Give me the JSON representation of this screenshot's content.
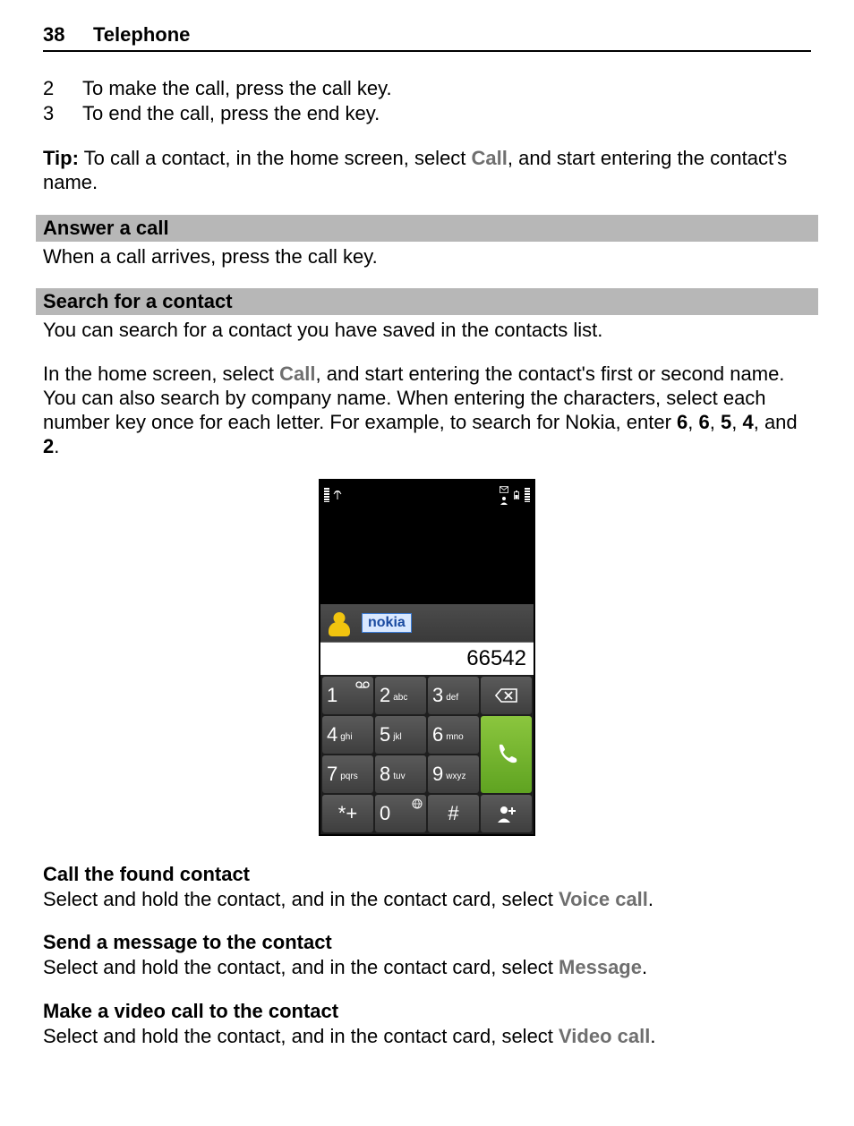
{
  "header": {
    "page_number": "38",
    "chapter": "Telephone"
  },
  "steps": [
    {
      "n": "2",
      "text": "To make the call, press the call key."
    },
    {
      "n": "3",
      "text": "To end the call, press the end key."
    }
  ],
  "tip": {
    "label": "Tip:",
    "before": " To call a contact, in the home screen, select ",
    "call_label": "Call",
    "after": ", and start entering the contact's name."
  },
  "answer": {
    "heading": "Answer a call",
    "text": "When a call arrives, press the call key."
  },
  "search": {
    "heading": "Search for a contact",
    "intro": "You can search for a contact you have saved in the contacts list.",
    "p_before": "In the home screen, select ",
    "call_label": "Call",
    "p_after1": ", and start entering the contact's first or second name. You can also search by company name. When entering the characters, select each number key once for each letter. For example, to search for Nokia, enter ",
    "d1": "6",
    "d2": "6",
    "d3": "5",
    "d4": "4",
    "d5": "2",
    "comma": ", ",
    "and": ", and ",
    "period": "."
  },
  "phone": {
    "match_text": "nokia",
    "typed_number": "66542",
    "keys": {
      "k1": "1",
      "k1s": "",
      "k2": "2",
      "k2s": "abc",
      "k3": "3",
      "k3s": "def",
      "k4": "4",
      "k4s": "ghi",
      "k5": "5",
      "k5s": "jkl",
      "k6": "6",
      "k6s": "mno",
      "k7": "7",
      "k7s": "pqrs",
      "k8": "8",
      "k8s": "tuv",
      "k9": "9",
      "k9s": "wxyz",
      "kstar": "*+",
      "k0": "0",
      "khash": "#"
    }
  },
  "call_found": {
    "heading": "Call the found contact",
    "before": "Select and hold the contact, and in the contact card, select ",
    "label": "Voice call",
    "after": "."
  },
  "send_msg": {
    "heading": "Send a message to the contact",
    "before": "Select and hold the contact, and in the contact card, select ",
    "label": "Message",
    "after": "."
  },
  "video_call": {
    "heading": "Make a video call to the contact",
    "before": "Select and hold the contact, and in the contact card, select ",
    "label": "Video call",
    "after": "."
  }
}
